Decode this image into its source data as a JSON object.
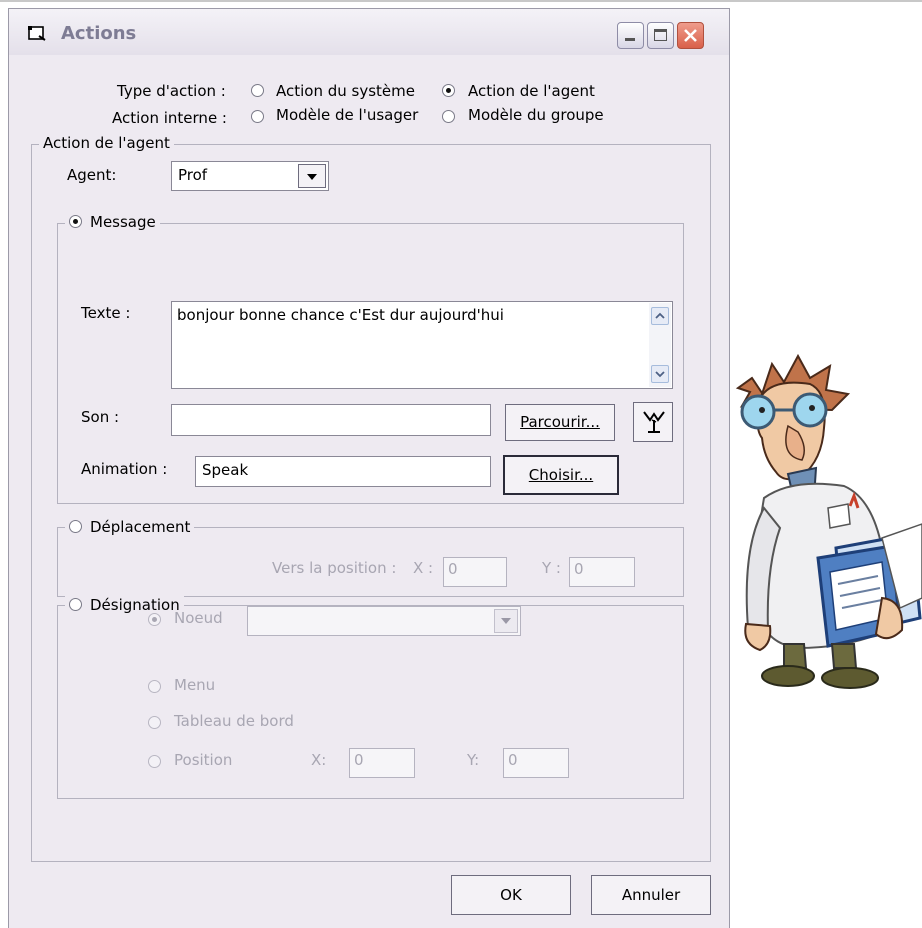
{
  "window": {
    "title": "Actions"
  },
  "type_action": {
    "label": "Type d'action :",
    "options": [
      "Action du système",
      "Action de l'agent"
    ],
    "selected": "Action de l'agent"
  },
  "action_interne": {
    "label": "Action interne :",
    "options": [
      "Modèle de l'usager",
      "Modèle du groupe"
    ]
  },
  "agent_group": {
    "legend": "Action de l'agent",
    "agent_label": "Agent:",
    "agent_value": "Prof"
  },
  "message": {
    "legend": "Message",
    "texte_label": "Texte :",
    "texte_value": "bonjour bonne chance c'Est dur aujourd'hui",
    "son_label": "Son :",
    "son_value": "",
    "parcourir": "Parcourir...",
    "animation_label": "Animation :",
    "animation_value": "Speak",
    "choisir": "Choisir..."
  },
  "deplacement": {
    "legend": "Déplacement",
    "vers_label": "Vers la position :",
    "x_label": "X :",
    "x_value": "0",
    "y_label": "Y :",
    "y_value": "0"
  },
  "designation": {
    "legend": "Désignation",
    "noeud": "Noeud",
    "noeud_value": "",
    "menu": "Menu",
    "tableau": "Tableau de bord",
    "position": "Position",
    "x_label": "X:",
    "x_value": "0",
    "y_label": "Y:",
    "y_value": "0"
  },
  "buttons": {
    "ok": "OK",
    "annuler": "Annuler"
  },
  "colors": {
    "window_bg": "#eeeaf1",
    "close_button": "#d9604a",
    "disabled_text": "#a8a6b2"
  },
  "icons": [
    "window-icon",
    "minimize-icon",
    "maximize-icon",
    "close-icon",
    "dropdown-arrow-icon",
    "sound-test-icon",
    "professor-character"
  ]
}
